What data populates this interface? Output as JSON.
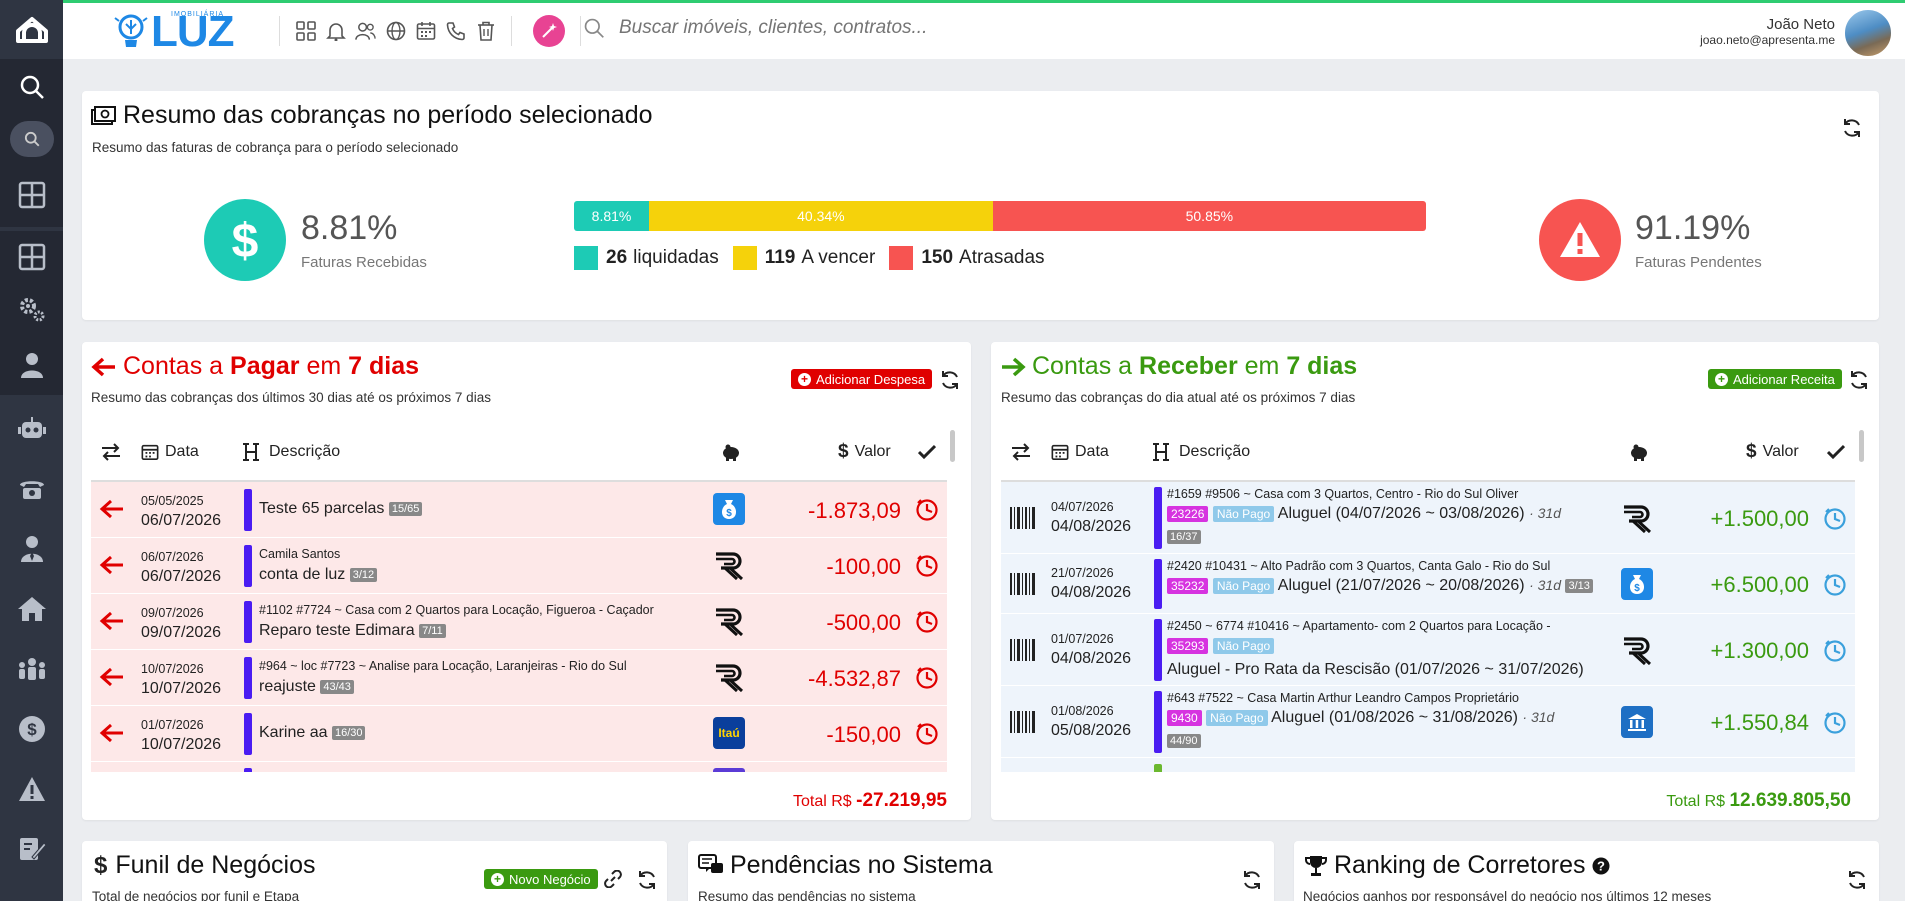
{
  "topbar": {
    "logo_text": "LUZ",
    "logo_sub": "IMOBILIÁRIA",
    "search_placeholder": "Buscar imóveis, clientes, contratos...",
    "user_name": "João Neto",
    "user_email": "joao.neto@apresenta.me"
  },
  "summary": {
    "title": "Resumo das cobranças no período selecionado",
    "subtitle": "Resumo das faturas de cobrança para o período selecionado",
    "received_pct": "8.81%",
    "received_label": "Faturas Recebidas",
    "pending_pct": "91.19%",
    "pending_label": "Faturas Pendentes",
    "bar": [
      {
        "label": "8.81%",
        "fraction": 0.0881,
        "color": "#1dcbb5"
      },
      {
        "label": "40.34%",
        "fraction": 0.4034,
        "color": "#f5d20b"
      },
      {
        "label": "50.85%",
        "fraction": 0.5085,
        "color": "#f75451"
      }
    ],
    "legend": [
      {
        "count": "26",
        "label": "liquidadas",
        "color": "#1dcbb5"
      },
      {
        "count": "119",
        "label": "A vencer",
        "color": "#f5d20b"
      },
      {
        "count": "150",
        "label": "Atrasadas",
        "color": "#f75451"
      }
    ]
  },
  "pagar": {
    "title_a": "Contas a ",
    "title_b": "Pagar",
    "title_c": " em ",
    "title_d": "7 dias",
    "subtitle": "Resumo das cobranças dos últimos 30 dias até os próximos 7 dias",
    "add_label": "Adicionar Despesa",
    "col_data": "Data",
    "col_desc": "Descrição",
    "col_valor": "Valor",
    "total_label": "Total R$",
    "total_value": "-27.219,95",
    "rows": [
      {
        "d1": "05/05/2025",
        "d2": "06/07/2026",
        "meta": "",
        "desc": "Teste 65 parcelas",
        "badge": "15/65",
        "bank": "sicoob",
        "value": "-1.873,09"
      },
      {
        "d1": "06/07/2026",
        "d2": "06/07/2026",
        "meta": "Camila Santos",
        "desc": "conta de luz",
        "badge": "3/12",
        "bank": "r",
        "value": "-100,00"
      },
      {
        "d1": "09/07/2026",
        "d2": "09/07/2026",
        "meta": "#1102 #7724 ~ Casa com 2 Quartos para Locação, Figueroa - Caçador",
        "desc": "Reparo teste Edimara",
        "badge": "7/11",
        "bank": "r",
        "value": "-500,00"
      },
      {
        "d1": "10/07/2026",
        "d2": "10/07/2026",
        "meta": "#964 ~ loc #7723 ~ Analise para Locação, Laranjeiras - Rio do Sul",
        "desc": "reajuste",
        "badge": "43/43",
        "bank": "r",
        "value": "-4.532,87"
      },
      {
        "d1": "01/07/2026",
        "d2": "10/07/2026",
        "meta": "",
        "desc": "Karine aa",
        "badge": "16/30",
        "bank": "itau",
        "value": "-150,00"
      }
    ]
  },
  "receber": {
    "title_a": "Contas a ",
    "title_b": "Receber",
    "title_c": " em ",
    "title_d": "7 dias",
    "subtitle": "Resumo das cobranças do dia atual até os próximos 7 dias",
    "add_label": "Adicionar Receita",
    "col_data": "Data",
    "col_desc": "Descrição",
    "col_valor": "Valor",
    "total_label": "Total R$",
    "total_value": "12.639.805,50",
    "rows": [
      {
        "d1": "04/07/2026",
        "d2": "04/08/2026",
        "meta": "#1659 #9506 ~ Casa com 3 Quartos, Centro - Rio do Sul Oliver",
        "tag": "23226",
        "status": "Não Pago",
        "desc": "Aluguel (04/07/2026 ~ 03/08/2026)",
        "days": "· 31d",
        "badge": "16/37",
        "bank": "r",
        "value": "+1.500,00"
      },
      {
        "d1": "21/07/2026",
        "d2": "04/08/2026",
        "meta": "#2420 #10431 ~ Alto Padrão com 3 Quartos, Canta Galo - Rio do Sul",
        "tag": "35232",
        "status": "Não Pago",
        "desc": "Aluguel (21/07/2026 ~ 20/08/2026)",
        "days": "· 31d",
        "badge": "3/13",
        "bank": "sicoob",
        "value": "+6.500,00"
      },
      {
        "d1": "01/07/2026",
        "d2": "04/08/2026",
        "meta": "#2450 ~ 6774 #10416 ~ Apartamento- com 2 Quartos para Locação -",
        "tag": "35293",
        "status": "Não Pago",
        "desc": "Aluguel - Pro Rata da Rescisão (01/07/2026 ~ 31/07/2026)",
        "days": "",
        "badge": "",
        "bank": "r",
        "value": "+1.300,00"
      },
      {
        "d1": "01/08/2026",
        "d2": "05/08/2026",
        "meta": "#643 #7522 ~ Casa Martin Arthur Leandro Campos Proprietário",
        "tag": "9430",
        "status": "Não Pago",
        "desc": "Aluguel (01/08/2026 ~ 31/08/2026)",
        "days": "· 31d",
        "badge": "44/90",
        "bank": "bb",
        "value": "+1.550,84"
      }
    ]
  },
  "funil": {
    "title": "Funil de Negócios",
    "subtitle": "Total de negócios por funil e Etapa",
    "add_label": "Novo Negócio"
  },
  "pendencias": {
    "title": "Pendências no Sistema",
    "subtitle": "Resumo das pendências no sistema"
  },
  "ranking": {
    "title": "Ranking de Corretores",
    "subtitle": "Negócios ganhos por responsável do negócio nos últimos 12 meses"
  },
  "colors": {
    "pagar": "#e00000",
    "receber": "#3a9a10",
    "pink_row": "#fde8e8",
    "blue_row": "#eef4fb",
    "sidebar": "#2f3542",
    "accent": "#1e88e5"
  }
}
